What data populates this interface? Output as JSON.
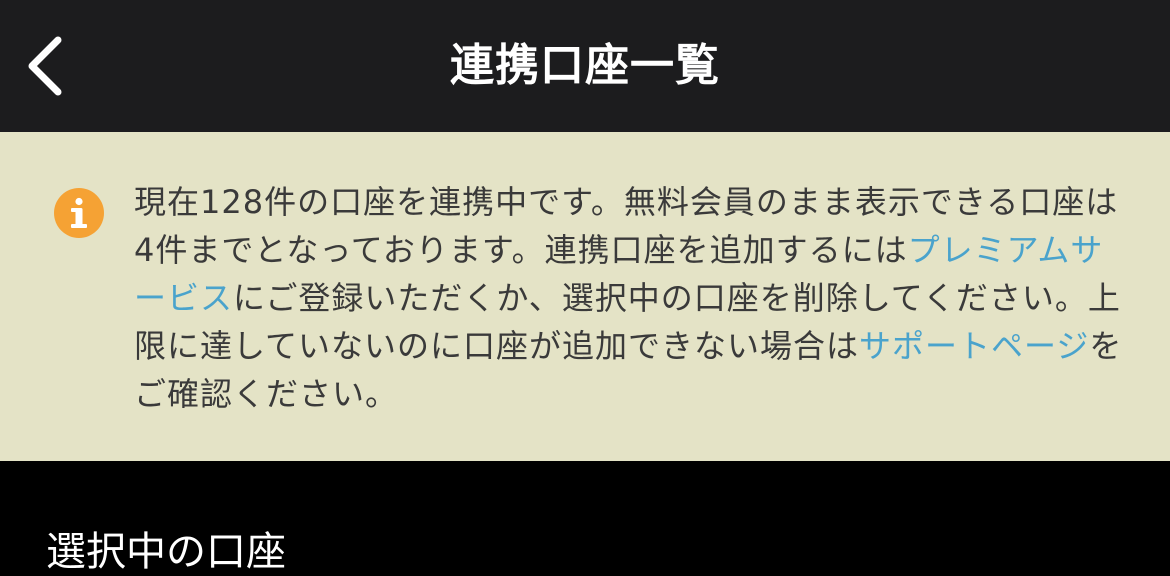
{
  "nav": {
    "title": "連携口座一覧",
    "back_icon": "chevron-left-icon"
  },
  "notice": {
    "icon": "info-icon",
    "icon_color": "#f5a234",
    "text_1": "現在128件の口座を連携中です。無料会員のまま表示できる口座は4件までとなっております。連携口座を追加するには",
    "premium_link": "プレミアムサービス",
    "text_2": "にご登録いただくか、選択中の口座を削除してください。上限に達していないのに口座が追加できない場合は",
    "support_link": "サポートページ",
    "text_3": "をご確認ください。"
  },
  "section": {
    "label": "選択中の口座"
  },
  "colors": {
    "nav_background": "#1c1c1e",
    "notice_background": "#e4e3c6",
    "link": "#4aa3cc",
    "page_background": "#000000"
  }
}
